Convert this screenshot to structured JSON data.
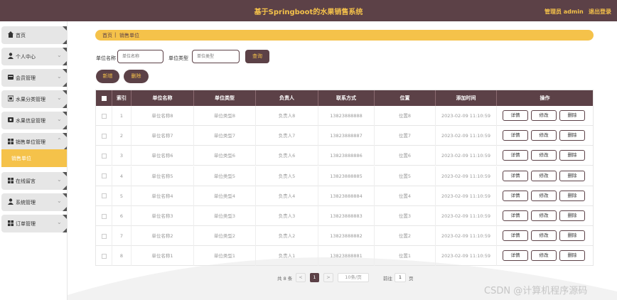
{
  "header": {
    "title": "基于Springboot的水果销售系统",
    "admin": "管理员 admin",
    "logout": "退出登录"
  },
  "sidebar": {
    "items": [
      {
        "label": "首页",
        "icon": "home-icon",
        "chevron": ""
      },
      {
        "label": "个人中心",
        "icon": "user-icon",
        "chevron": "⌄"
      },
      {
        "label": "会员管理",
        "icon": "member-icon",
        "chevron": "⌄"
      },
      {
        "label": "水果分类管理",
        "icon": "category-icon",
        "chevron": "⌄"
      },
      {
        "label": "水果信息管理",
        "icon": "fruit-icon",
        "chevron": "⌄"
      },
      {
        "label": "销售单位管理",
        "icon": "grid-icon",
        "chevron": "⌃"
      },
      {
        "label": "在线留言",
        "icon": "grid-icon",
        "chevron": "⌄"
      },
      {
        "label": "系统管理",
        "icon": "user-icon",
        "chevron": "⌄"
      },
      {
        "label": "订单管理",
        "icon": "grid-icon",
        "chevron": "⌄"
      }
    ],
    "active_sub": "销售单位"
  },
  "breadcrumb": {
    "home": "首页",
    "sep": "|",
    "current": "销售单位"
  },
  "search": {
    "name_label": "单位名称",
    "name_placeholder": "单位名称",
    "type_label": "单位类型",
    "type_placeholder": "单位类型",
    "query_button": "查询"
  },
  "actions": {
    "add": "新增",
    "delete": "删除"
  },
  "table": {
    "columns": [
      "索引",
      "单位名称",
      "单位类型",
      "负责人",
      "联系方式",
      "位置",
      "添加时间",
      "操作"
    ],
    "rows": [
      {
        "index": "1",
        "name": "单位名称8",
        "type": "单位类型8",
        "owner": "负责人8",
        "phone": "13823888888",
        "location": "位置8",
        "time": "2023-02-09 11:10:59"
      },
      {
        "index": "2",
        "name": "单位名称7",
        "type": "单位类型7",
        "owner": "负责人7",
        "phone": "13823888887",
        "location": "位置7",
        "time": "2023-02-09 11:10:59"
      },
      {
        "index": "3",
        "name": "单位名称6",
        "type": "单位类型6",
        "owner": "负责人6",
        "phone": "13823888886",
        "location": "位置6",
        "time": "2023-02-09 11:10:59"
      },
      {
        "index": "4",
        "name": "单位名称5",
        "type": "单位类型5",
        "owner": "负责人5",
        "phone": "13823888885",
        "location": "位置5",
        "time": "2023-02-09 11:10:59"
      },
      {
        "index": "5",
        "name": "单位名称4",
        "type": "单位类型4",
        "owner": "负责人4",
        "phone": "13823888884",
        "location": "位置4",
        "time": "2023-02-09 11:10:59"
      },
      {
        "index": "6",
        "name": "单位名称3",
        "type": "单位类型3",
        "owner": "负责人3",
        "phone": "13823888883",
        "location": "位置3",
        "time": "2023-02-09 11:10:59"
      },
      {
        "index": "7",
        "name": "单位名称2",
        "type": "单位类型2",
        "owner": "负责人2",
        "phone": "13823888882",
        "location": "位置2",
        "time": "2023-02-09 11:10:59"
      },
      {
        "index": "8",
        "name": "单位名称1",
        "type": "单位类型1",
        "owner": "负责人1",
        "phone": "13823888881",
        "location": "位置1",
        "time": "2023-02-09 11:10:59"
      }
    ],
    "ops": {
      "detail": "详情",
      "edit": "修改",
      "delete": "删除"
    }
  },
  "pagination": {
    "total": "共 8 条",
    "prev": "<",
    "current": "1",
    "next": ">",
    "page_size": "10条/页",
    "goto_label": "前往",
    "goto_value": "1",
    "page_suffix": "页"
  },
  "watermark": "CSDN @计算机程序源码",
  "colors": {
    "primary": "#5c4147",
    "accent": "#f5c24a",
    "menu_bg": "#e6e6e6"
  }
}
